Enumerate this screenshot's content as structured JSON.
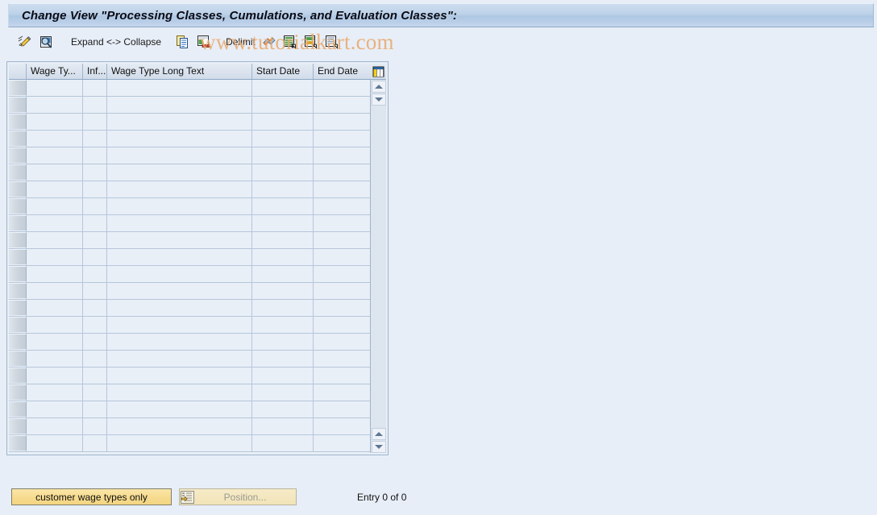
{
  "window": {
    "title": "Change View \"Processing Classes, Cumulations, and Evaluation Classes\":"
  },
  "watermark": {
    "text": "www.tutorialkart.com",
    "color": "#e9a86b"
  },
  "toolbar": {
    "items": [
      {
        "name": "change-icon",
        "label": "",
        "tooltip": "Change"
      },
      {
        "name": "display-icon",
        "label": "",
        "tooltip": "Display"
      },
      {
        "name": "expand-collapse-label",
        "label": "Expand <-> Collapse"
      },
      {
        "name": "copy-as-icon",
        "label": "",
        "tooltip": "Copy As..."
      },
      {
        "name": "delimit-icon",
        "label": "",
        "tooltip": "Delimit"
      },
      {
        "name": "delimit-label",
        "label": "Delimit"
      },
      {
        "name": "undo-icon",
        "label": "",
        "tooltip": "Undo"
      },
      {
        "name": "select-all-icon",
        "label": "",
        "tooltip": "Select All"
      },
      {
        "name": "select-block-icon",
        "label": "",
        "tooltip": "Select Block"
      },
      {
        "name": "deselect-all-icon",
        "label": "",
        "tooltip": "Deselect All"
      }
    ],
    "expand_collapse_label": "Expand <-> Collapse",
    "delimit_label": "Delimit"
  },
  "table": {
    "columns": [
      {
        "key": "selector",
        "label": ""
      },
      {
        "key": "wage_type",
        "label": "Wage Ty..."
      },
      {
        "key": "infotype",
        "label": "Inf..."
      },
      {
        "key": "long_text",
        "label": "Wage Type Long Text"
      },
      {
        "key": "start_date",
        "label": "Start Date"
      },
      {
        "key": "end_date",
        "label": "End Date"
      }
    ],
    "config_icon": "column-config-icon",
    "rows": [],
    "empty_row_count": 22
  },
  "footer": {
    "customer_wage_types_label": "customer wage types only",
    "position_label": "Position...",
    "entry_status": "Entry 0 of 0"
  }
}
